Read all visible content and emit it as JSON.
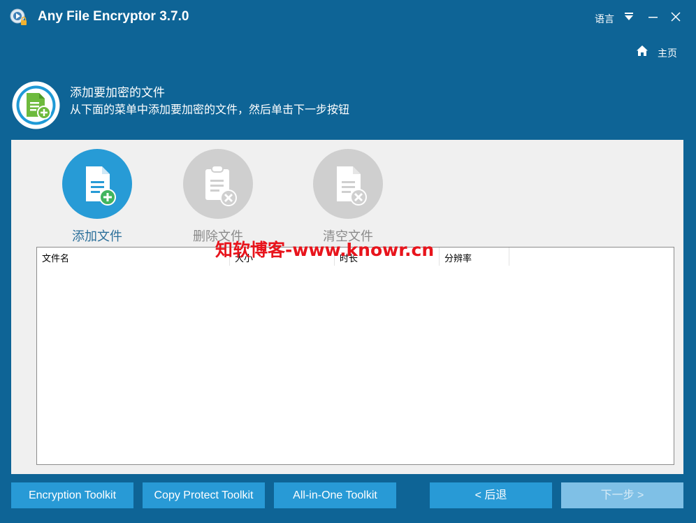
{
  "window": {
    "title": "Any File Encryptor 3.7.0",
    "language_label": "语言"
  },
  "nav": {
    "home_label": "主页"
  },
  "step": {
    "title": "添加要加密的文件",
    "description": "从下面的菜单中添加要加密的文件，然后单击下一步按钮"
  },
  "actions": {
    "add_files": "添加文件",
    "remove_file": "删除文件",
    "clear_files": "清空文件"
  },
  "watermark": "知软博客-www.knowr.cn",
  "table": {
    "columns": [
      "文件名",
      "大小",
      "时长",
      "分辨率"
    ],
    "rows": []
  },
  "footer": {
    "encryption_toolkit": "Encryption Toolkit",
    "copy_protect_toolkit": "Copy Protect Toolkit",
    "all_in_one_toolkit": "All-in-One Toolkit",
    "back": "< 后退",
    "next": "下一步 >"
  },
  "colors": {
    "background": "#0e6496",
    "accent": "#289ad6",
    "panel": "#f0f0f0",
    "watermark": "#e8141c"
  }
}
